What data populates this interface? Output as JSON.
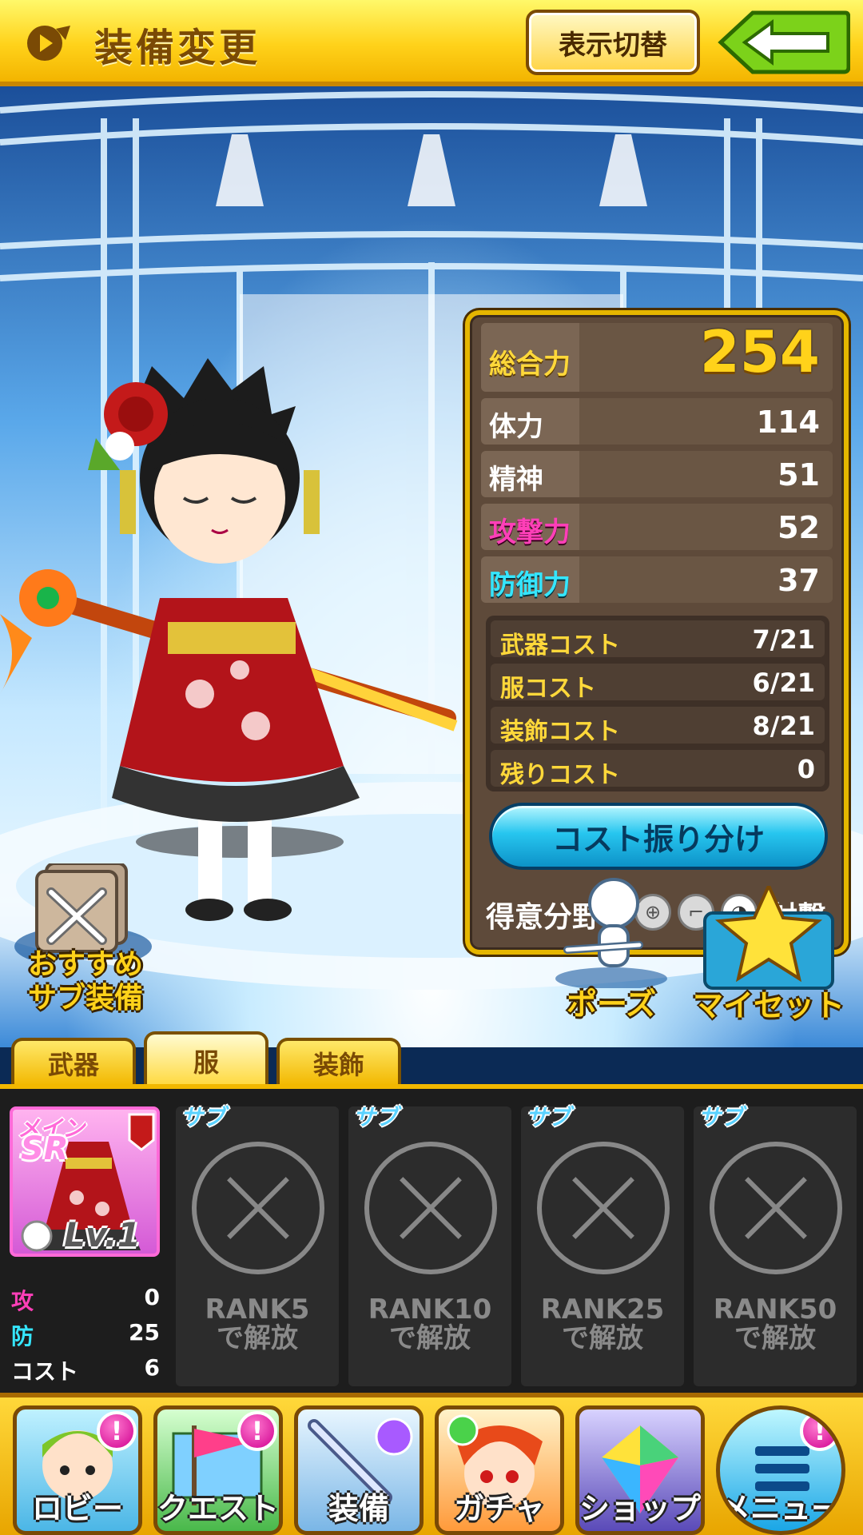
{
  "header": {
    "title": "装備変更",
    "toggle_label": "表示切替"
  },
  "stats": {
    "total": {
      "label": "総合力",
      "value": "254"
    },
    "rows": [
      {
        "label": "体力",
        "value": "114"
      },
      {
        "label": "精神",
        "value": "51"
      },
      {
        "label": "攻撃力",
        "value": "52"
      },
      {
        "label": "防御力",
        "value": "37"
      }
    ],
    "costs": [
      {
        "label": "武器コスト",
        "value": "7/21"
      },
      {
        "label": "服コスト",
        "value": "6/21"
      },
      {
        "label": "装飾コスト",
        "value": "8/21"
      },
      {
        "label": "残りコスト",
        "value": "0"
      }
    ],
    "cost_button": "コスト振り分け",
    "specialty": {
      "label": "得意分野",
      "value": "射撃"
    }
  },
  "actions": {
    "recommended_sub": "おすすめ\nサブ装備",
    "pose": "ポーズ",
    "myset": "マイセット"
  },
  "tabs": [
    {
      "label": "武器"
    },
    {
      "label": "服",
      "active": true
    },
    {
      "label": "装飾"
    }
  ],
  "main_equip": {
    "tag": "メイン",
    "rarity": "SR",
    "level": "Lv.1",
    "stats": [
      {
        "label": "攻",
        "value": "0",
        "color": "#ff3fb8"
      },
      {
        "label": "防",
        "value": "25",
        "color": "#35e6ff"
      },
      {
        "label": "コスト",
        "value": "6",
        "color": "#ffffff"
      }
    ]
  },
  "sub_slots": [
    {
      "tag": "サブ",
      "unlock": "RANK5\nで解放"
    },
    {
      "tag": "サブ",
      "unlock": "RANK10\nで解放"
    },
    {
      "tag": "サブ",
      "unlock": "RANK25\nで解放"
    },
    {
      "tag": "サブ",
      "unlock": "RANK50\nで解放"
    }
  ],
  "nav": [
    {
      "label": "ロビー",
      "icon": "lobby-icon",
      "badge": "!"
    },
    {
      "label": "クエスト",
      "icon": "quest-icon",
      "badge": "!"
    },
    {
      "label": "装備",
      "icon": "equipment-icon"
    },
    {
      "label": "ガチャ",
      "icon": "gacha-icon"
    },
    {
      "label": "ショップ",
      "icon": "shop-icon"
    },
    {
      "label": "メニュー",
      "icon": "menu-icon",
      "badge": "!"
    }
  ]
}
